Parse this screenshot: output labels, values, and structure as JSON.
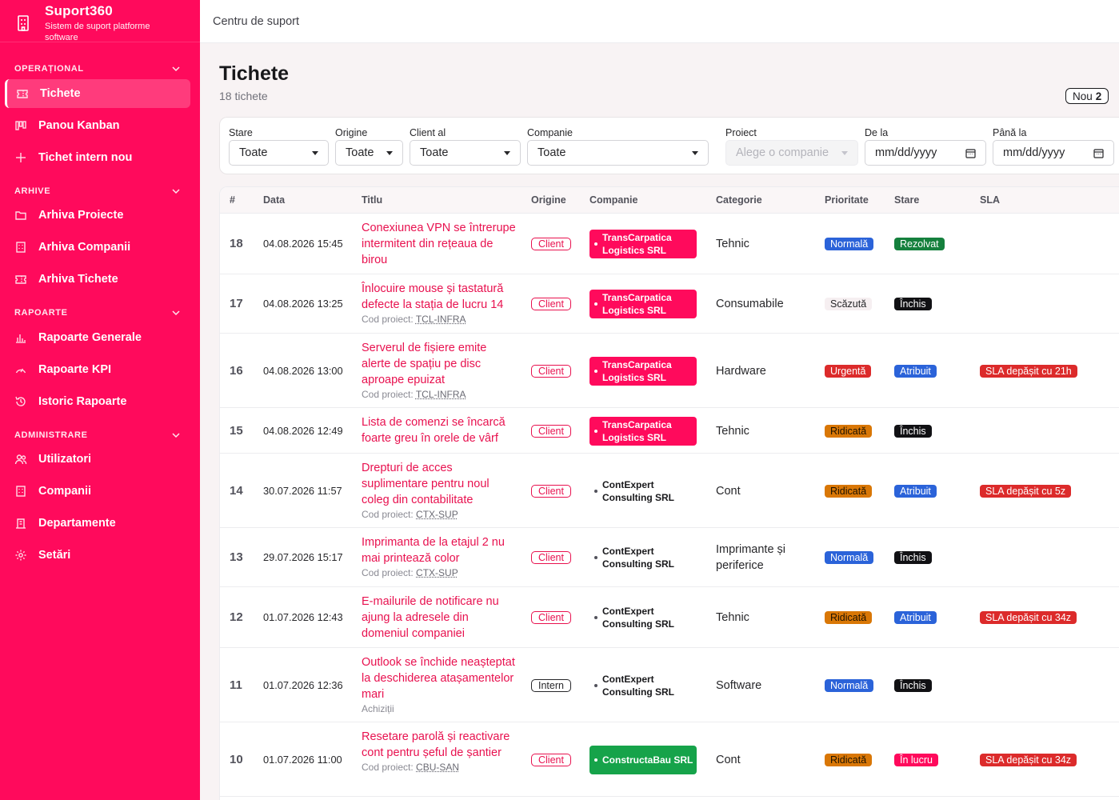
{
  "app": {
    "name": "Suport360",
    "subtitle": "Sistem de suport platforme software"
  },
  "topbar": {
    "title": "Centru de suport"
  },
  "sidebar": {
    "sections": [
      {
        "label": "OPERAȚIONAL",
        "items": [
          {
            "label": "Tichete",
            "icon": "ticket-icon",
            "active": true
          },
          {
            "label": "Panou Kanban",
            "icon": "kanban-icon"
          },
          {
            "label": "Tichet intern nou",
            "icon": "plus-icon"
          }
        ]
      },
      {
        "label": "ARHIVE",
        "items": [
          {
            "label": "Arhiva Proiecte",
            "icon": "folder-icon"
          },
          {
            "label": "Arhiva Companii",
            "icon": "building-icon"
          },
          {
            "label": "Arhiva Tichete",
            "icon": "ticket-icon"
          }
        ]
      },
      {
        "label": "RAPOARTE",
        "items": [
          {
            "label": "Rapoarte Generale",
            "icon": "bar-chart-icon"
          },
          {
            "label": "Rapoarte KPI",
            "icon": "gauge-icon"
          },
          {
            "label": "Istoric Rapoarte",
            "icon": "history-icon"
          }
        ]
      },
      {
        "label": "ADMINISTRARE",
        "items": [
          {
            "label": "Utilizatori",
            "icon": "users-icon"
          },
          {
            "label": "Companii",
            "icon": "building-icon"
          },
          {
            "label": "Departamente",
            "icon": "department-icon"
          },
          {
            "label": "Setări",
            "icon": "gear-icon"
          }
        ]
      }
    ]
  },
  "page": {
    "title": "Tichete",
    "count": "18 tichete",
    "new_label": "Nou",
    "new_count": "2"
  },
  "filters": {
    "stare": {
      "label": "Stare",
      "value": "Toate"
    },
    "origine": {
      "label": "Origine",
      "value": "Toate"
    },
    "client": {
      "label": "Client al",
      "value": "Toate"
    },
    "companie": {
      "label": "Companie",
      "value": "Toate"
    },
    "proiect": {
      "label": "Proiect",
      "placeholder": "Alege o companie"
    },
    "de_la": {
      "label": "De la",
      "value": "mm/dd/yyyy"
    },
    "pana_la": {
      "label": "Până la",
      "value": "mm/dd/yyyy"
    }
  },
  "table": {
    "columns": [
      "#",
      "Data",
      "Titlu",
      "Origine",
      "Companie",
      "Categorie",
      "Prioritate",
      "Stare",
      "SLA"
    ],
    "project_prefix": "Cod proiect:",
    "rows": [
      {
        "id": "18",
        "date": "04.08.2026 15:45",
        "title": "Conexiunea VPN se întrerupe intermitent din rețeaua de birou",
        "project": "",
        "origin": "Client",
        "company": "TransCarpatica Logistics SRL",
        "company_style": "pink",
        "category": "Tehnic",
        "priority": "Normală",
        "priority_style": "normal",
        "status": "Rezolvat",
        "status_style": "rezolvat",
        "sla": ""
      },
      {
        "id": "17",
        "date": "04.08.2026 13:25",
        "title": "Înlocuire mouse și tastatură defecte la stația de lucru 14",
        "project": "TCL-INFRA",
        "origin": "Client",
        "company": "TransCarpatica Logistics SRL",
        "company_style": "pink",
        "category": "Consumabile",
        "priority": "Scăzută",
        "priority_style": "low",
        "status": "Închis",
        "status_style": "inchis",
        "sla": ""
      },
      {
        "id": "16",
        "date": "04.08.2026 13:00",
        "title": "Serverul de fișiere emite alerte de spațiu pe disc aproape epuizat",
        "project": "TCL-INFRA",
        "origin": "Client",
        "company": "TransCarpatica Logistics SRL",
        "company_style": "pink",
        "category": "Hardware",
        "priority": "Urgentă",
        "priority_style": "urgent",
        "status": "Atribuit",
        "status_style": "atribuit",
        "sla": "SLA depășit cu 21h"
      },
      {
        "id": "15",
        "date": "04.08.2026 12:49",
        "title": "Lista de comenzi se încarcă foarte greu în orele de vârf",
        "project": "",
        "origin": "Client",
        "company": "TransCarpatica Logistics SRL",
        "company_style": "pink",
        "category": "Tehnic",
        "priority": "Ridicată",
        "priority_style": "high",
        "status": "Închis",
        "status_style": "inchis",
        "sla": ""
      },
      {
        "id": "14",
        "date": "30.07.2026 11:57",
        "title": "Drepturi de acces suplimentare pentru noul coleg din contabilitate",
        "project": "CTX-SUP",
        "origin": "Client",
        "company": "ContExpert Consulting SRL",
        "company_style": "plain",
        "category": "Cont",
        "priority": "Ridicată",
        "priority_style": "high",
        "status": "Atribuit",
        "status_style": "atribuit",
        "sla": "SLA depășit cu 5z"
      },
      {
        "id": "13",
        "date": "29.07.2026 15:17",
        "title": "Imprimanta de la etajul 2 nu mai printează color",
        "project": "CTX-SUP",
        "origin": "Client",
        "company": "ContExpert Consulting SRL",
        "company_style": "plain",
        "category": "Imprimante și periferice",
        "priority": "Normală",
        "priority_style": "normal",
        "status": "Închis",
        "status_style": "inchis",
        "sla": ""
      },
      {
        "id": "12",
        "date": "01.07.2026 12:43",
        "title": "E-mailurile de notificare nu ajung la adresele din domeniul companiei",
        "project": "",
        "origin": "Client",
        "company": "ContExpert Consulting SRL",
        "company_style": "plain",
        "category": "Tehnic",
        "priority": "Ridicată",
        "priority_style": "high",
        "status": "Atribuit",
        "status_style": "atribuit",
        "sla": "SLA depășit cu 34z"
      },
      {
        "id": "11",
        "date": "01.07.2026 12:36",
        "title": "Outlook se închide neașteptat la deschiderea atașamentelor mari",
        "project": "",
        "subline": "Achiziții",
        "origin": "Intern",
        "company": "ContExpert Consulting SRL",
        "company_style": "plain",
        "category": "Software",
        "priority": "Normală",
        "priority_style": "normal",
        "status": "Închis",
        "status_style": "inchis",
        "sla": ""
      },
      {
        "id": "10",
        "date": "01.07.2026 11:00",
        "title": "Resetare parolă și reactivare cont pentru șeful de șantier",
        "project": "CBU-SAN",
        "origin": "Client",
        "company": "ConstructaBau SRL",
        "company_style": "green",
        "category": "Cont",
        "priority": "Ridicată",
        "priority_style": "high",
        "status": "În lucru",
        "status_style": "lucru",
        "sla": "SLA depășit cu 34z"
      }
    ]
  },
  "colors": {
    "brand": "#ff0a5c",
    "link": "#e8114f",
    "normal": "#2b63d9",
    "urgent": "#dc2b2b",
    "high": "#d97706",
    "resolved": "#15803d"
  }
}
